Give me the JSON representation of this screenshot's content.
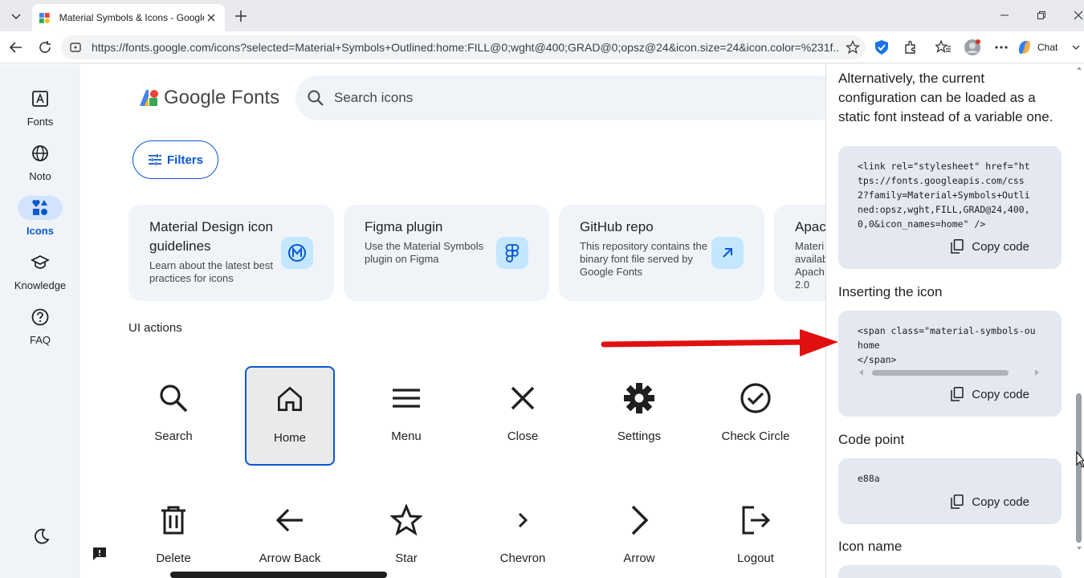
{
  "browser": {
    "tab_title": "Material Symbols & Icons - Google Fonts",
    "url": "https://fonts.google.com/icons?selected=Material+Symbols+Outlined:home:FILL@0;wght@400;GRAD@0;opsz@24&icon.size=24&icon.color=%231f...",
    "chat_label": "Chat"
  },
  "rail": {
    "items": [
      {
        "label": "Fonts",
        "icon": "fonts-icon"
      },
      {
        "label": "Noto",
        "icon": "globe-icon"
      },
      {
        "label": "Icons",
        "icon": "icons-category-icon",
        "active": true
      },
      {
        "label": "Knowledge",
        "icon": "school-icon"
      },
      {
        "label": "FAQ",
        "icon": "help-icon"
      }
    ]
  },
  "header": {
    "logo_text": "Google Fonts",
    "search_placeholder": "Search icons",
    "filters_label": "Filters"
  },
  "cards": [
    {
      "title": "Material Design icon guidelines",
      "desc": "Learn about the latest best practices for icons",
      "icon": "material-logo-icon"
    },
    {
      "title": "Figma plugin",
      "desc": "Use the Material Symbols plugin on Figma",
      "icon": "figma-icon"
    },
    {
      "title": "GitHub repo",
      "desc": "This repository contains the binary font file served by Google Fonts",
      "icon": "arrow-outward-icon"
    },
    {
      "title": "Apac",
      "desc": "Materi availab Apach 2.0",
      "icon": ""
    }
  ],
  "section_title": "UI actions",
  "icons": [
    {
      "label": "Search",
      "icon": "search-icon"
    },
    {
      "label": "Home",
      "icon": "home-icon",
      "selected": true
    },
    {
      "label": "Menu",
      "icon": "menu-icon"
    },
    {
      "label": "Close",
      "icon": "close-icon"
    },
    {
      "label": "Settings",
      "icon": "settings-icon"
    },
    {
      "label": "Check Circle",
      "icon": "check-circle-icon"
    },
    {
      "label": "Delete",
      "icon": "delete-icon"
    },
    {
      "label": "Arrow Back",
      "icon": "arrow-back-icon"
    },
    {
      "label": "Star",
      "icon": "star-icon"
    },
    {
      "label": "Chevron",
      "icon": "chevron-icon"
    },
    {
      "label": "Arrow",
      "icon": "arrow-icon"
    },
    {
      "label": "Logout",
      "icon": "logout-icon"
    }
  ],
  "side_panel": {
    "intro": "Alternatively, the current configuration can be loaded as a static font instead of a variable one.",
    "stylesheet_code": "<link rel=\"stylesheet\" href=\"ht\ntps://fonts.googleapis.com/css\n2?family=Material+Symbols+Outli\nned:opsz,wght,FILL,GRAD@24,400,\n0,0&icon_names=home\" />",
    "inserting_heading": "Inserting the icon",
    "inserting_code": "<span class=\"material-symbols-ou\nhome\n</span>",
    "code_point_heading": "Code point",
    "code_point": "e88a",
    "icon_name_heading": "Icon name",
    "copy_label": "Copy code"
  },
  "colors": {
    "accent": "#0b57d0",
    "annotation_arrow": "#e01010"
  }
}
